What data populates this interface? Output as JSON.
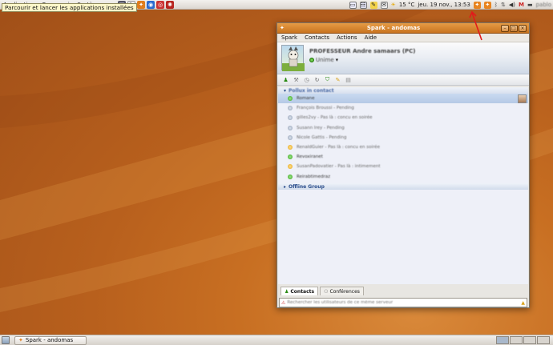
{
  "top_panel": {
    "menus": [
      "Applications",
      "Raccourcis",
      "Système"
    ],
    "tooltip": "Parcourir et lancer les applications installées",
    "weather": "15 °C",
    "datetime": "jeu. 19 nov., 13:53",
    "user": "pablo"
  },
  "window": {
    "title": "Spark - andomas",
    "menu": [
      "Spark",
      "Contacts",
      "Actions",
      "Aide"
    ],
    "profile": {
      "name": "PROFESSEUR Andre samaars (PC)",
      "status": "Unime"
    },
    "groups": [
      {
        "name": "Pollux in contact",
        "contacts": [
          {
            "name": "Romane",
            "status": "on",
            "selected": true
          },
          {
            "name": "François Broussi - Pending",
            "status": "off"
          },
          {
            "name": "gilles2vy - Pas là : concu en soirée",
            "status": "off"
          },
          {
            "name": "Susann lrey - Pending",
            "status": "off"
          },
          {
            "name": "Nicole Gattis - Pending",
            "status": "off"
          },
          {
            "name": "RenaldGuier - Pas là : concu en soirée",
            "status": "away"
          },
          {
            "name": "Revoxiranet",
            "status": "on"
          },
          {
            "name": "SusanPadovatier - Pas là : intimement",
            "status": "away"
          },
          {
            "name": "Reirabtimedraz",
            "status": "on"
          }
        ]
      }
    ],
    "offline_group": "Offline Group",
    "tabs": [
      "Contacts",
      "Conférences"
    ],
    "search_placeholder": "Rechercher les utilisateurs de ce même serveur"
  },
  "taskbar": {
    "task_label": "Spark - andomas"
  }
}
